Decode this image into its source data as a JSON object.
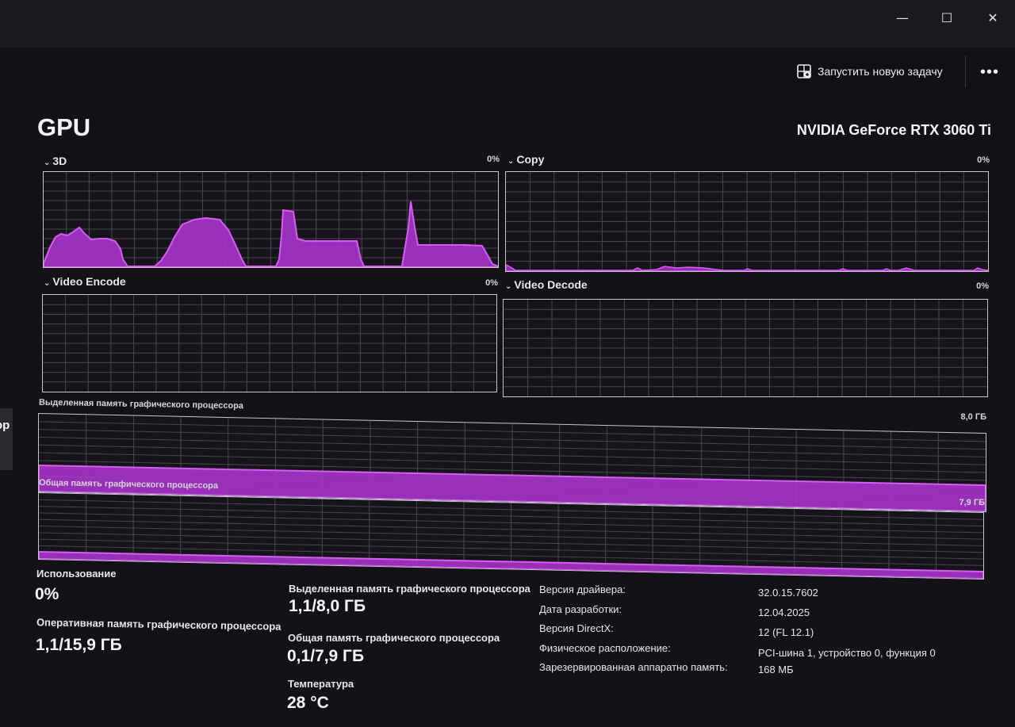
{
  "window": {
    "minimize": "—",
    "maximize": "☐",
    "close": "✕"
  },
  "toolbar": {
    "run_task_label": "Запустить новую задачу",
    "more": "•••"
  },
  "sidebar": {
    "partial_tab": "ор"
  },
  "header": {
    "title": "GPU",
    "gpu_name": "NVIDIA GeForce RTX 3060 Ti"
  },
  "engines": [
    {
      "name": "3D",
      "percent": "0%"
    },
    {
      "name": "Copy",
      "percent": "0%"
    },
    {
      "name": "Video Encode",
      "percent": "0%"
    },
    {
      "name": "Video Decode",
      "percent": "0%"
    }
  ],
  "memory_graphs": {
    "dedicated": {
      "label": "Выделенная память графического процессора",
      "max": "8,0 ГБ"
    },
    "shared": {
      "label": "Общая память графического процессора",
      "max": "7,9 ГБ"
    }
  },
  "stats": {
    "usage": {
      "label": "Использование",
      "value": "0%"
    },
    "gpu_ram": {
      "label": "Оперативная память графического процессора",
      "value": "1,1/15,9 ГБ"
    },
    "dedicated": {
      "label": "Выделенная память графического процессора",
      "value": "1,1/8,0 ГБ"
    },
    "shared": {
      "label": "Общая память графического процессора",
      "value": "0,1/7,9 ГБ"
    },
    "temperature": {
      "label": "Температура",
      "value": "28 °C"
    }
  },
  "info": [
    {
      "key": "Версия драйвера:",
      "value": "32.0.15.7602"
    },
    {
      "key": "Дата разработки:",
      "value": "12.04.2025"
    },
    {
      "key": "Версия DirectX:",
      "value": "12 (FL 12.1)"
    },
    {
      "key": "Физическое расположение:",
      "value": "PCI-шина 1, устройство 0, функция 0"
    },
    {
      "key": "Зарезервированная аппаратно память:",
      "value": "168 МБ"
    }
  ],
  "colors": {
    "accent": "#b03ad0",
    "accent_line": "#d65cf5",
    "grid": "#4a4650",
    "border": "#c9c5cf"
  }
}
